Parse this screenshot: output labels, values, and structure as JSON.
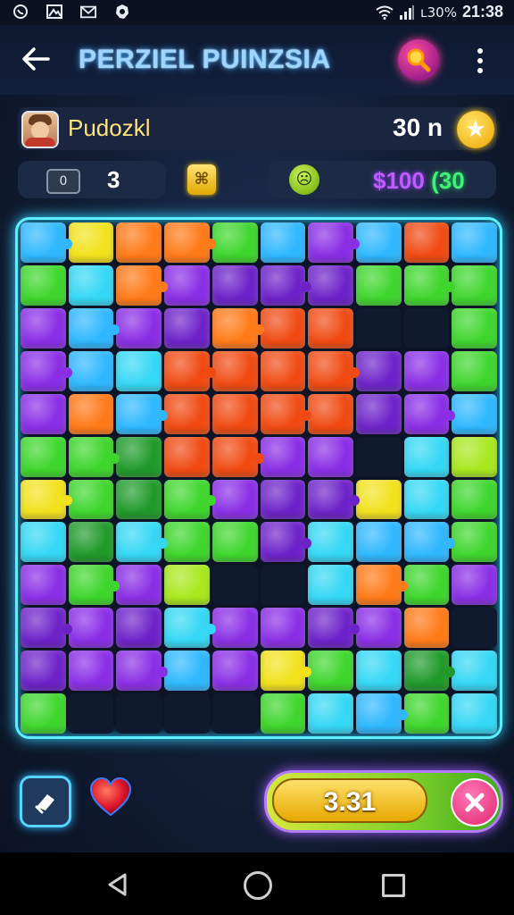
{
  "status_bar": {
    "left_icons": [
      "whatsapp-icon",
      "gallery-icon",
      "mail-icon",
      "settings-icon"
    ],
    "battery": "ʟ30%",
    "time": "21:38"
  },
  "header": {
    "title": "PERZIEL PUINZSIA",
    "back_icon": "arrow-left-icon",
    "search_icon": "search-icon",
    "more_icon": "more-vertical-icon"
  },
  "player": {
    "name": "Pudozkl",
    "coins": "30 n",
    "star_icon": "star-icon"
  },
  "stats": {
    "moves": "3",
    "moves_icon_text": "0",
    "money": "$100",
    "bonus": "(30"
  },
  "timer": {
    "value": "3.31"
  },
  "colors": {
    "blue": "#2fb8ff",
    "cyan": "#34d8f5",
    "green": "#3ed62c",
    "darkgreen": "#1f9a2a",
    "lime": "#a8e81e",
    "yellow": "#f2e21c",
    "orange": "#ff7a18",
    "red": "#f04a12",
    "purple": "#8a2ee6",
    "violet": "#6d22c9",
    "empty": "#0f1a2f"
  },
  "board": {
    "rows": 12,
    "cols": 10,
    "tiles": [
      [
        "blue",
        "yellow",
        "orange",
        "orange",
        "green",
        "blue",
        "purple",
        "blue",
        "red",
        "blue"
      ],
      [
        "green",
        "cyan",
        "orange",
        "purple",
        "violet",
        "violet",
        "violet",
        "green",
        "green",
        "green"
      ],
      [
        "purple",
        "blue",
        "purple",
        "violet",
        "orange",
        "red",
        "red",
        "empty",
        "empty",
        "green"
      ],
      [
        "purple",
        "blue",
        "cyan",
        "red",
        "red",
        "red",
        "red",
        "violet",
        "purple",
        "green"
      ],
      [
        "purple",
        "orange",
        "blue",
        "red",
        "red",
        "red",
        "red",
        "violet",
        "purple",
        "blue"
      ],
      [
        "green",
        "green",
        "darkgreen",
        "red",
        "red",
        "purple",
        "purple",
        "empty",
        "cyan",
        "lime"
      ],
      [
        "yellow",
        "green",
        "darkgreen",
        "green",
        "purple",
        "violet",
        "violet",
        "yellow",
        "cyan",
        "green"
      ],
      [
        "cyan",
        "darkgreen",
        "cyan",
        "green",
        "green",
        "violet",
        "cyan",
        "blue",
        "blue",
        "green"
      ],
      [
        "purple",
        "green",
        "purple",
        "lime",
        "empty",
        "empty",
        "cyan",
        "orange",
        "green",
        "purple"
      ],
      [
        "violet",
        "purple",
        "violet",
        "cyan",
        "purple",
        "purple",
        "violet",
        "purple",
        "orange",
        "empty"
      ],
      [
        "violet",
        "purple",
        "purple",
        "blue",
        "purple",
        "yellow",
        "green",
        "cyan",
        "darkgreen",
        "cyan"
      ],
      [
        "green",
        "empty",
        "empty",
        "empty",
        "empty",
        "green",
        "cyan",
        "blue",
        "green",
        "cyan"
      ]
    ]
  },
  "controls": {
    "hint_icon": "eraser-icon",
    "heart_icon": "heart-icon",
    "close_icon": "close-icon"
  },
  "nav": {
    "back": "nav-back-icon",
    "home": "nav-home-icon",
    "recents": "nav-recents-icon"
  }
}
